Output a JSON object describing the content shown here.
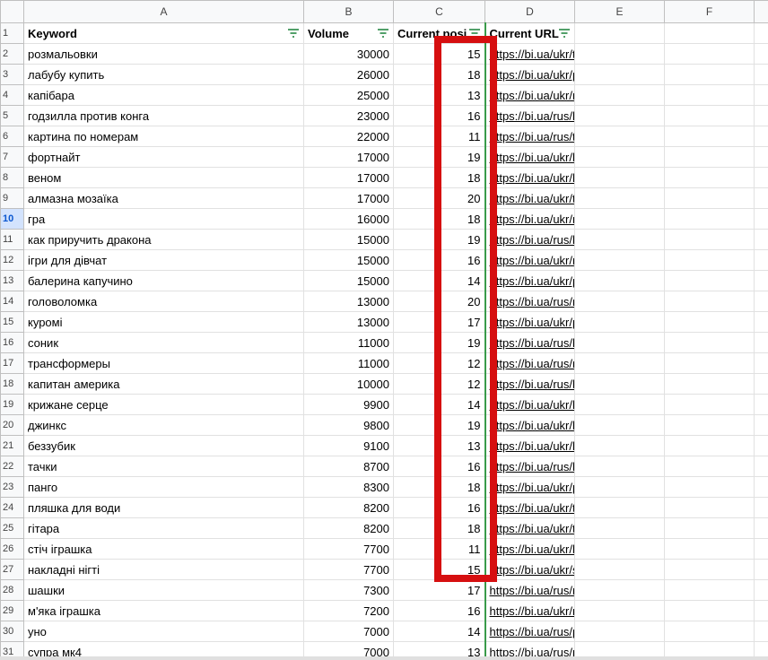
{
  "columns": [
    "A",
    "B",
    "C",
    "D",
    "E",
    "F"
  ],
  "active_row": "10",
  "header": {
    "keyword": "Keyword",
    "volume": "Volume",
    "position": "Current posi",
    "url": "Current URL"
  },
  "rows": [
    {
      "n": "2",
      "keyword": "розмальовки",
      "volume": "30000",
      "pos": "15",
      "url": "https://bi.ua/ukr/tvorchestvo-i-razvitie/tovari-dlya-ri"
    },
    {
      "n": "3",
      "keyword": "лабубу купить",
      "volume": "26000",
      "pos": "18",
      "url": "https://bi.ua/ukr/product/kollekcionnaya-figurka-syu"
    },
    {
      "n": "4",
      "keyword": "капібара",
      "volume": "25000",
      "pos": "13",
      "url": "https://bi.ua/ukr/myagkie-igrushki/myagkie-zhivotnie"
    },
    {
      "n": "5",
      "keyword": "годзилла против конга",
      "volume": "23000",
      "pos": "16",
      "url": "https://bi.ua/rus/brands/godzilla-vs-kong/"
    },
    {
      "n": "6",
      "keyword": "картина по номерам",
      "volume": "22000",
      "pos": "11",
      "url": "https://bi.ua/rus/tvorchestvo-i-razvitie/tovari-dlya-ris"
    },
    {
      "n": "7",
      "keyword": "фортнайт",
      "volume": "17000",
      "pos": "19",
      "url": "https://bi.ua/ukr/brands/fortnite/"
    },
    {
      "n": "8",
      "keyword": "веном",
      "volume": "17000",
      "pos": "18",
      "url": "https://bi.ua/ukr/hero/geroi-marvel/venom/"
    },
    {
      "n": "9",
      "keyword": "алмазна мозаїка",
      "volume": "17000",
      "pos": "20",
      "url": "https://bi.ua/ukr/tvorchestvo-i-razvitie/mozaika/alm"
    },
    {
      "n": "10",
      "keyword": "гра",
      "volume": "16000",
      "pos": "18",
      "url": "https://bi.ua/ukr/nastolnye-igry-i-pazly/nastolnye-igr"
    },
    {
      "n": "11",
      "keyword": "как приручить дракона",
      "volume": "15000",
      "pos": "19",
      "url": "https://bi.ua/rus/brands/dragons/"
    },
    {
      "n": "12",
      "keyword": "ігри для дівчат",
      "volume": "15000",
      "pos": "16",
      "url": "https://bi.ua/ukr/nastolnye-igry-i-pazly/nastolnye-igr"
    },
    {
      "n": "13",
      "keyword": "балерина капучино",
      "volume": "15000",
      "pos": "14",
      "url": "https://bi.ua/ukr/product/myagkaya-igrushka-kopicy"
    },
    {
      "n": "14",
      "keyword": "головоломка",
      "volume": "13000",
      "pos": "20",
      "url": "https://bi.ua/rus/nastolnye-igry-i-pazly/golovolomki/"
    },
    {
      "n": "15",
      "keyword": "куромі",
      "volume": "13000",
      "pos": "17",
      "url": "https://bi.ua/ukr/product/myagkaya-igrushka-hello-k"
    },
    {
      "n": "16",
      "keyword": "соник",
      "volume": "11000",
      "pos": "19",
      "url": "https://bi.ua/rus/hero/sonic/"
    },
    {
      "n": "17",
      "keyword": "трансформеры",
      "volume": "11000",
      "pos": "12",
      "url": "https://bi.ua/rus/mashinki-modeli-tehnika/transform"
    },
    {
      "n": "18",
      "keyword": "капитан америка",
      "volume": "10000",
      "pos": "12",
      "url": "https://bi.ua/rus/hero/geroi-marvel/kapitan-amerika"
    },
    {
      "n": "19",
      "keyword": "крижане серце",
      "volume": "9900",
      "pos": "14",
      "url": "https://bi.ua/ukr/hero/frozen/"
    },
    {
      "n": "20",
      "keyword": "джинкс",
      "volume": "9800",
      "pos": "19",
      "url": "https://bi.ua/ukr/brands/jnx/"
    },
    {
      "n": "21",
      "keyword": "беззубик",
      "volume": "9100",
      "pos": "13",
      "url": "https://bi.ua/ukr/brands/dragons/"
    },
    {
      "n": "22",
      "keyword": "тачки",
      "volume": "8700",
      "pos": "16",
      "url": "https://bi.ua/rus/brands/cars/"
    },
    {
      "n": "23",
      "keyword": "панго",
      "volume": "8300",
      "pos": "18",
      "url": "https://bi.ua/ukr/product/interaktivnaya-igrushka-m"
    },
    {
      "n": "24",
      "keyword": "пляшка для води",
      "volume": "8200",
      "pos": "16",
      "url": "https://bi.ua/ukr/tovary-dlja-shkoly/butylki-dlja-vody"
    },
    {
      "n": "25",
      "keyword": "гітара",
      "volume": "8200",
      "pos": "18",
      "url": "https://bi.ua/ukr/tvorchestvo-i-razvitie/muzikalnie-ir"
    },
    {
      "n": "26",
      "keyword": "стіч іграшка",
      "volume": "7700",
      "pos": "11",
      "url": "https://bi.ua/ukr/brands/stitch/"
    },
    {
      "n": "27",
      "keyword": "накладні нігті",
      "volume": "7700",
      "pos": "15",
      "url": "https://bi.ua/ukr/sjuzhetno-rolevye-nabory/kosmetik"
    },
    {
      "n": "28",
      "keyword": "шашки",
      "volume": "7300",
      "pos": "17",
      "url": "https://bi.ua/rus/nastolnye-igry-i-pazly/nastolnye-igr"
    },
    {
      "n": "29",
      "keyword": "м'яка іграшка",
      "volume": "7200",
      "pos": "16",
      "url": "https://bi.ua/ukr/myagkie-igrushki/"
    },
    {
      "n": "30",
      "keyword": "уно",
      "volume": "7000",
      "pos": "14",
      "url": "https://bi.ua/rus/posts/view/12-sposobov-igry-v-unc"
    },
    {
      "n": "31",
      "keyword": "супра мк4",
      "volume": "7000",
      "pos": "13",
      "url": "https://bi.ua/rus/product/konstruktor-lego-technic-fa"
    }
  ]
}
